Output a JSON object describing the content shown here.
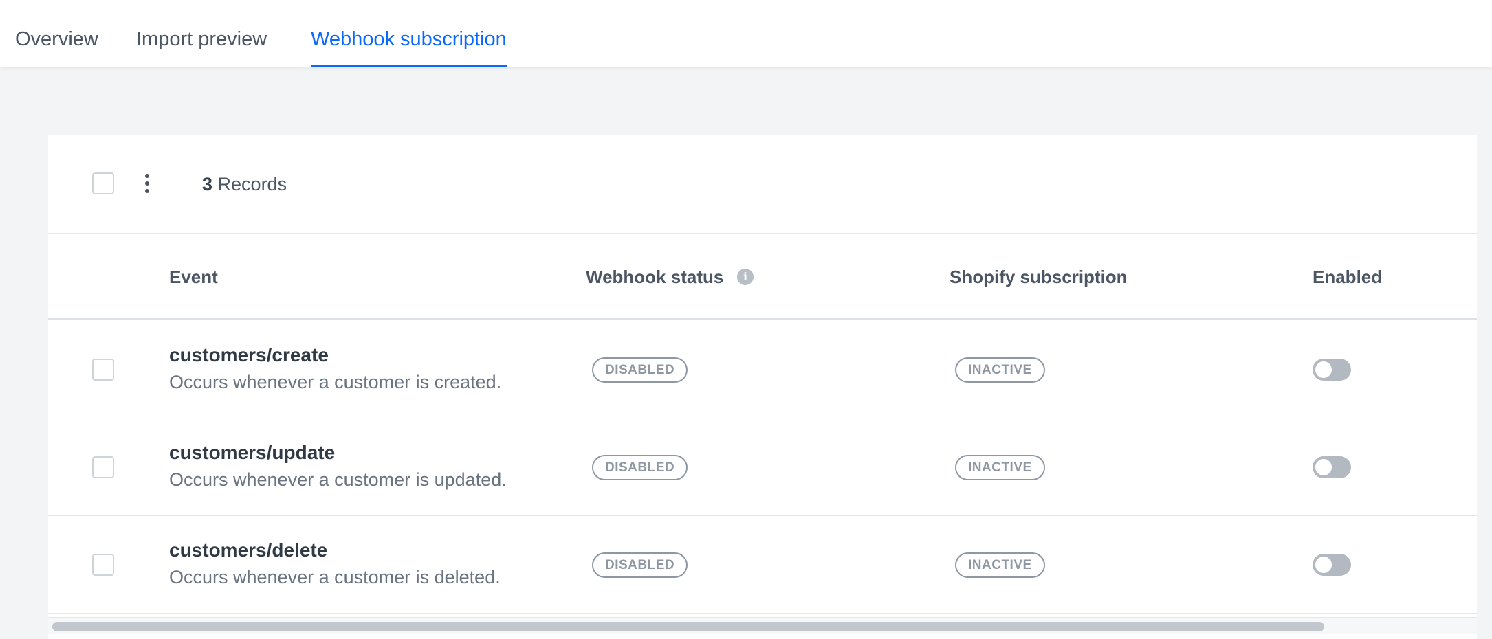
{
  "tabs": [
    {
      "label": "Overview",
      "active": false
    },
    {
      "label": "Import preview",
      "active": false
    },
    {
      "label": "Webhook subscription",
      "active": true
    }
  ],
  "toolbar": {
    "record_count": "3",
    "record_label": " Records"
  },
  "table": {
    "columns": [
      "Event",
      "Webhook status",
      "Shopify subscription",
      "Enabled"
    ],
    "rows": [
      {
        "event": "customers/create",
        "description": "Occurs whenever a customer is created.",
        "webhook_status": "DISABLED",
        "shopify_subscription": "INACTIVE",
        "enabled": false
      },
      {
        "event": "customers/update",
        "description": "Occurs whenever a customer is updated.",
        "webhook_status": "DISABLED",
        "shopify_subscription": "INACTIVE",
        "enabled": false
      },
      {
        "event": "customers/delete",
        "description": "Occurs whenever a customer is deleted.",
        "webhook_status": "DISABLED",
        "shopify_subscription": "INACTIVE",
        "enabled": false
      }
    ]
  },
  "colors": {
    "accent": "#0b68ff",
    "badge": "#8e97a2",
    "toggle_off": "#b3b9c1"
  },
  "icons": {
    "column_info": "info-icon",
    "bulk_menu": "kebab-menu-icon"
  }
}
